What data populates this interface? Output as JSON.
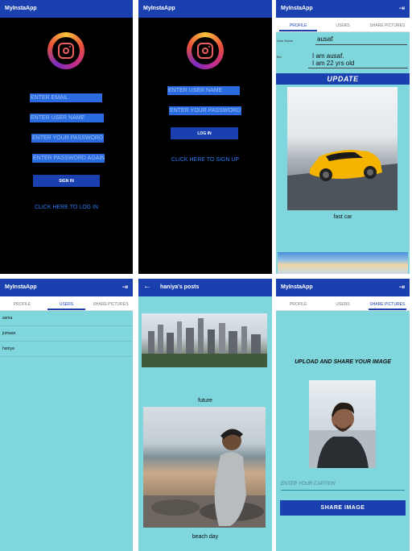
{
  "app_title": "MyInstaApp",
  "tabs": {
    "profile": "PROFILE",
    "users": "USERS",
    "share": "SHARE PICTURES"
  },
  "signup_screen": {
    "email_placeholder": "ENTER EMAIL",
    "username_placeholder": "ENTER USER NAME",
    "password_placeholder": "ENTER YOUR PASSWORD",
    "password_again_placeholder": "ENTER PASSWORD AGAIN",
    "signin_button": "SIGN IN",
    "login_link": "CLICK HERE TO LOG IN"
  },
  "login_screen": {
    "username_placeholder": "ENTER USER NAME",
    "password_placeholder": "ENTER YOUR PASSWORD",
    "login_button": "LOG IN",
    "signup_link": "CLICK HERE TO SIGN UP"
  },
  "profile_screen": {
    "username_label": "User Name",
    "username_value": "ausaf",
    "bio_label": "Bio",
    "bio_line1": "I am ausaf.",
    "bio_line2": "I am 22 yrs old",
    "update_button": "UPDATE",
    "post_caption": "fast car"
  },
  "users_screen": {
    "users": [
      "asma",
      "jumaan",
      "haniya"
    ]
  },
  "posts_screen": {
    "title": "haniya's posts",
    "captions": [
      "future",
      "beach day"
    ]
  },
  "share_screen": {
    "heading": "UPLOAD AND SHARE YOUR IMAGE",
    "caption_placeholder": "ENTER YOUR CAPTION",
    "share_button": "SHARE IMAGE"
  },
  "colors": {
    "primary": "#1a3fae",
    "background_light": "#7fd6dd",
    "input_blue": "#2a6be0",
    "link_blue": "#2f7bf5"
  },
  "icons": {
    "logout": "logout-icon",
    "back": "back-arrow-icon",
    "logo": "instagram-logo-icon"
  }
}
